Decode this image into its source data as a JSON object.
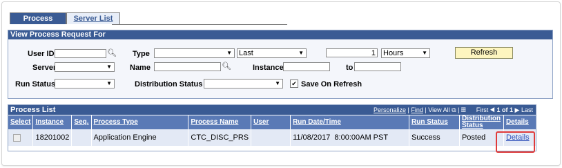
{
  "tabs": {
    "process_list": "Process List",
    "server_list": "Server List"
  },
  "filter": {
    "title": "View Process Request For",
    "user_id_label": "User ID",
    "type_label": "Type",
    "range_value": "Last",
    "count_value": "1",
    "unit_value": "Hours",
    "refresh_label": "Refresh",
    "server_label": "Server",
    "name_label": "Name",
    "instance_label": "Instance",
    "to_label": "to",
    "run_status_label": "Run Status",
    "distribution_status_label": "Distribution Status",
    "save_on_refresh_label": "Save On Refresh",
    "save_on_refresh_checked": true
  },
  "grid": {
    "title": "Process List",
    "personalize": "Personalize",
    "find": "Find",
    "view_all": "View All",
    "first": "First",
    "range": "1 of 1",
    "last": "Last",
    "columns": [
      "Select",
      "Instance",
      "Seq.",
      "Process Type",
      "Process Name",
      "User",
      "Run Date/Time",
      "Run Status",
      "Distribution Status",
      "Details"
    ],
    "rows": [
      {
        "instance": "18201002",
        "seq": "",
        "process_type": "Application Engine",
        "process_name": "CTC_DISC_PRS",
        "user": "",
        "run_datetime": "11/08/2017  8:00:00AM PST",
        "run_status": "Success",
        "distribution_status": "Posted",
        "details": "Details"
      }
    ]
  },
  "colors": {
    "header_blue": "#3a5b94",
    "column_blue": "#5a7ab6",
    "row_bg": "#e3e9f5",
    "highlight": "#e03a3a",
    "button_yellow": "#fdf5bf"
  }
}
